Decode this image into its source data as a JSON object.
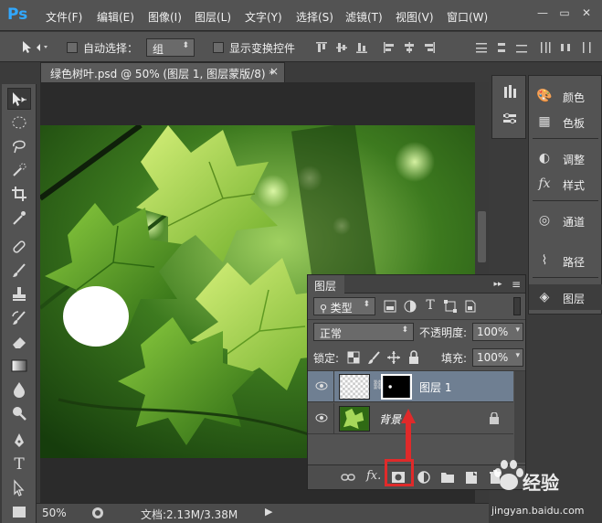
{
  "app": {
    "logo_text": "Ps",
    "logo_color": "#31a8ff"
  },
  "menu": {
    "items": [
      "文件(F)",
      "编辑(E)",
      "图像(I)",
      "图层(L)",
      "文字(Y)",
      "选择(S)",
      "滤镜(T)",
      "视图(V)",
      "窗口(W)"
    ],
    "window_controls": [
      "—",
      "▭",
      "✕"
    ]
  },
  "options": {
    "auto_select_label": "自动选择：",
    "auto_select_checked": false,
    "target_value": "组",
    "show_transform_label": "显示变换控件",
    "show_transform_checked": false
  },
  "document": {
    "tab_title": "绿色树叶.psd @ 50% (图层 1, 图层蒙版/8) *",
    "close_label": "×"
  },
  "status": {
    "zoom": "50%",
    "doc_info": "文档:2.13M/3.38M"
  },
  "dock": {
    "panels": [
      {
        "label": "颜色",
        "icon": "palette-icon"
      },
      {
        "label": "色板",
        "icon": "swatches-icon"
      },
      {
        "label": "调整",
        "icon": "adjustments-icon"
      },
      {
        "label": "样式",
        "icon": "styles-icon"
      },
      {
        "label": "通道",
        "icon": "channels-icon"
      },
      {
        "label": "路径",
        "icon": "paths-icon"
      },
      {
        "label": "图层",
        "icon": "layers-icon"
      }
    ]
  },
  "layers_panel": {
    "tab_label": "图层",
    "filter_kind": "类型",
    "blend_mode": "正常",
    "opacity_label": "不透明度:",
    "opacity_value": "100%",
    "lock_label": "锁定:",
    "fill_label": "填充:",
    "fill_value": "100%",
    "layers": [
      {
        "name": "图层 1",
        "selected": true,
        "visible": true,
        "has_mask": true
      },
      {
        "name": "背景",
        "selected": false,
        "visible": true,
        "locked": true
      }
    ],
    "footer_icons": [
      "link-icon",
      "fx-icon",
      "add-mask-icon",
      "adjustment-layer-icon",
      "group-icon",
      "new-layer-icon",
      "trash-icon"
    ],
    "fx_label": "fx."
  },
  "annotation": {
    "highlight_color": "#e02a2a"
  },
  "watermark": {
    "brand": "Bai",
    "brand_cn": "经验",
    "url": "jingyan.baidu.com"
  }
}
